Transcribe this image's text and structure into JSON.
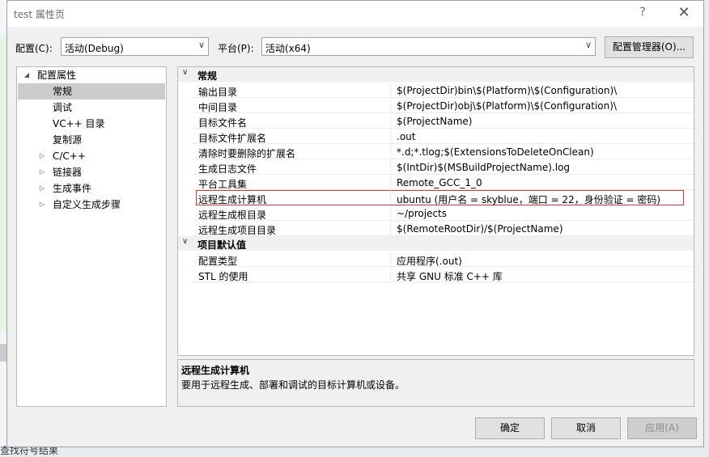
{
  "background": {
    "bottom_text": "查找符号结果"
  },
  "window": {
    "title": "test 属性页",
    "help": "?",
    "close": "✕"
  },
  "config": {
    "label": "配置(C):",
    "value": "活动(Debug)"
  },
  "platform": {
    "label": "平台(P):",
    "value": "活动(x64)"
  },
  "config_manager_label": "配置管理器(O)...",
  "tree": {
    "root": "配置属性",
    "items": [
      {
        "label": "常规",
        "selected": true
      },
      {
        "label": "调试"
      },
      {
        "label": "VC++ 目录"
      },
      {
        "label": "复制源"
      },
      {
        "label": "C/C++",
        "expandable": true
      },
      {
        "label": "链接器",
        "expandable": true
      },
      {
        "label": "生成事件",
        "expandable": true
      },
      {
        "label": "自定义生成步骤",
        "expandable": true
      }
    ]
  },
  "properties": {
    "general": {
      "title": "常规",
      "rows": [
        {
          "name": "输出目录",
          "value": "$(ProjectDir)bin\\$(Platform)\\$(Configuration)\\"
        },
        {
          "name": "中间目录",
          "value": "$(ProjectDir)obj\\$(Platform)\\$(Configuration)\\"
        },
        {
          "name": "目标文件名",
          "value": "$(ProjectName)"
        },
        {
          "name": "目标文件扩展名",
          "value": ".out"
        },
        {
          "name": "清除时要删除的扩展名",
          "value": "*.d;*.tlog;$(ExtensionsToDeleteOnClean)"
        },
        {
          "name": "生成日志文件",
          "value": "$(IntDir)$(MSBuildProjectName).log"
        },
        {
          "name": "平台工具集",
          "value": "Remote_GCC_1_0"
        },
        {
          "name": "远程生成计算机",
          "value": "ubuntu (用户名 = skyblue，端口 = 22，身份验证 = 密码)"
        },
        {
          "name": "远程生成根目录",
          "value": "~/projects"
        },
        {
          "name": "远程生成项目目录",
          "value": "$(RemoteRootDir)/$(ProjectName)"
        }
      ]
    },
    "defaults": {
      "title": "项目默认值",
      "rows": [
        {
          "name": "配置类型",
          "value": "应用程序(.out)"
        },
        {
          "name": "STL 的使用",
          "value": "共享 GNU 标准 C++ 库"
        }
      ]
    }
  },
  "description": {
    "title": "远程生成计算机",
    "text": "要用于远程生成、部署和调试的目标计算机或设备。"
  },
  "buttons": {
    "ok": "确定",
    "cancel": "取消",
    "apply": "应用(A)"
  },
  "icons": {
    "expanded": "triangle-down-icon",
    "collapsed": "triangle-right-icon",
    "category_chevron": "chevron-down-icon"
  }
}
